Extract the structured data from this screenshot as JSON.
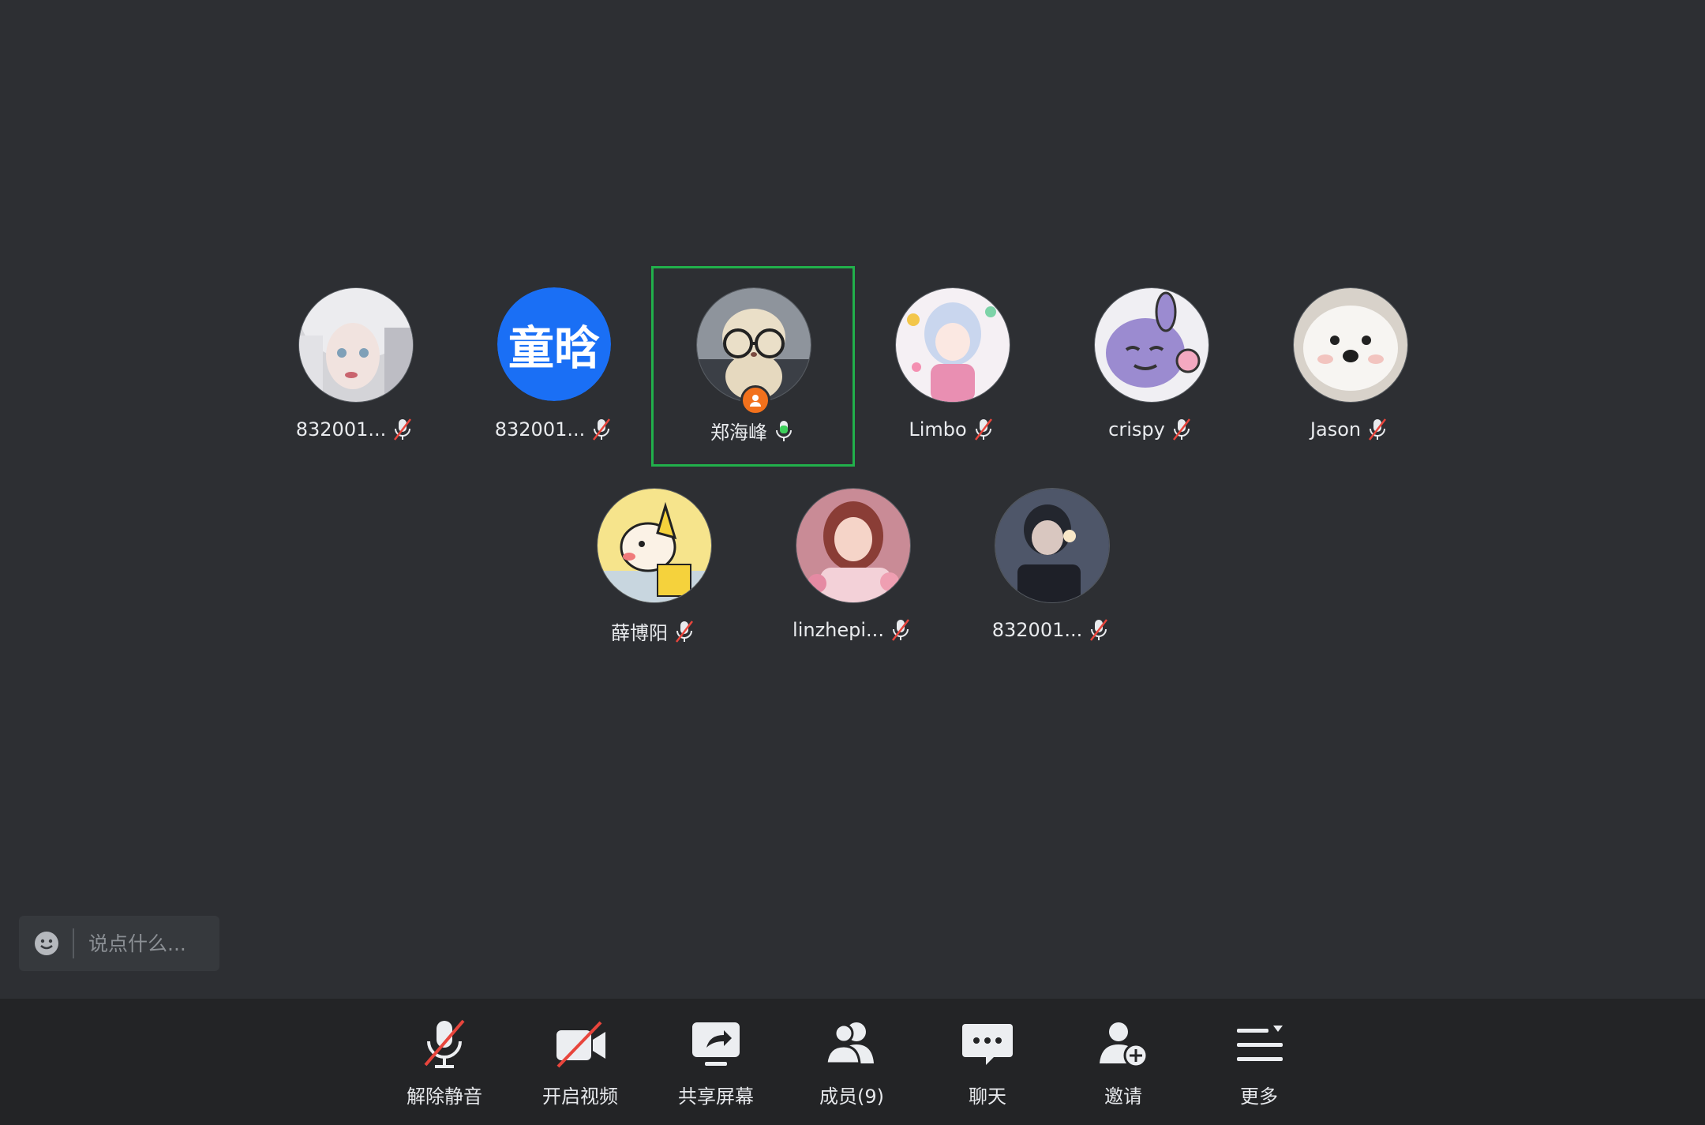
{
  "participants": [
    {
      "name": "832001...",
      "mic": "muted",
      "avatar": "photo",
      "avatar_colors": [
        "#d9d9dc",
        "#b7b8bd"
      ]
    },
    {
      "name": "832001...",
      "mic": "muted",
      "avatar": "text",
      "avatar_text": "童晗",
      "avatar_colors": [
        "#1a6ff5"
      ]
    },
    {
      "name": "郑海峰",
      "mic": "speaking",
      "avatar": "photo",
      "avatar_colors": [
        "#9aa0a8",
        "#e8dcc6"
      ],
      "host": true,
      "active": true
    },
    {
      "name": "Limbo",
      "mic": "muted",
      "avatar": "photo",
      "avatar_colors": [
        "#f3eef5",
        "#c7d4ec"
      ]
    },
    {
      "name": "crispy",
      "mic": "muted",
      "avatar": "photo",
      "avatar_colors": [
        "#eeeef2",
        "#8f7ec3"
      ]
    },
    {
      "name": "Jason",
      "mic": "muted",
      "avatar": "photo",
      "avatar_colors": [
        "#d9d3cc",
        "#f4f2f0"
      ]
    },
    {
      "name": "薛博阳",
      "mic": "muted",
      "avatar": "photo",
      "avatar_colors": [
        "#f5e28a",
        "#f4f1e6"
      ]
    },
    {
      "name": "linzhepi...",
      "mic": "muted",
      "avatar": "photo",
      "avatar_colors": [
        "#d59aa6",
        "#f0c9cc"
      ]
    },
    {
      "name": "832001...",
      "mic": "muted",
      "avatar": "photo",
      "avatar_colors": [
        "#5a6478",
        "#2e3342"
      ]
    }
  ],
  "chat": {
    "placeholder": "说点什么..."
  },
  "toolbar": {
    "unmute_label": "解除静音",
    "video_label": "开启视频",
    "share_label": "共享屏幕",
    "members_label": "成员(9)",
    "chat_label": "聊天",
    "invite_label": "邀请",
    "more_label": "更多"
  },
  "colors": {
    "background": "#2d2f33",
    "toolbar": "#232426",
    "active_outline": "#21b04b",
    "mute_slash": "#e8453c",
    "speaking_mic": "#3ccf5a",
    "host_badge": "#f2711c"
  }
}
